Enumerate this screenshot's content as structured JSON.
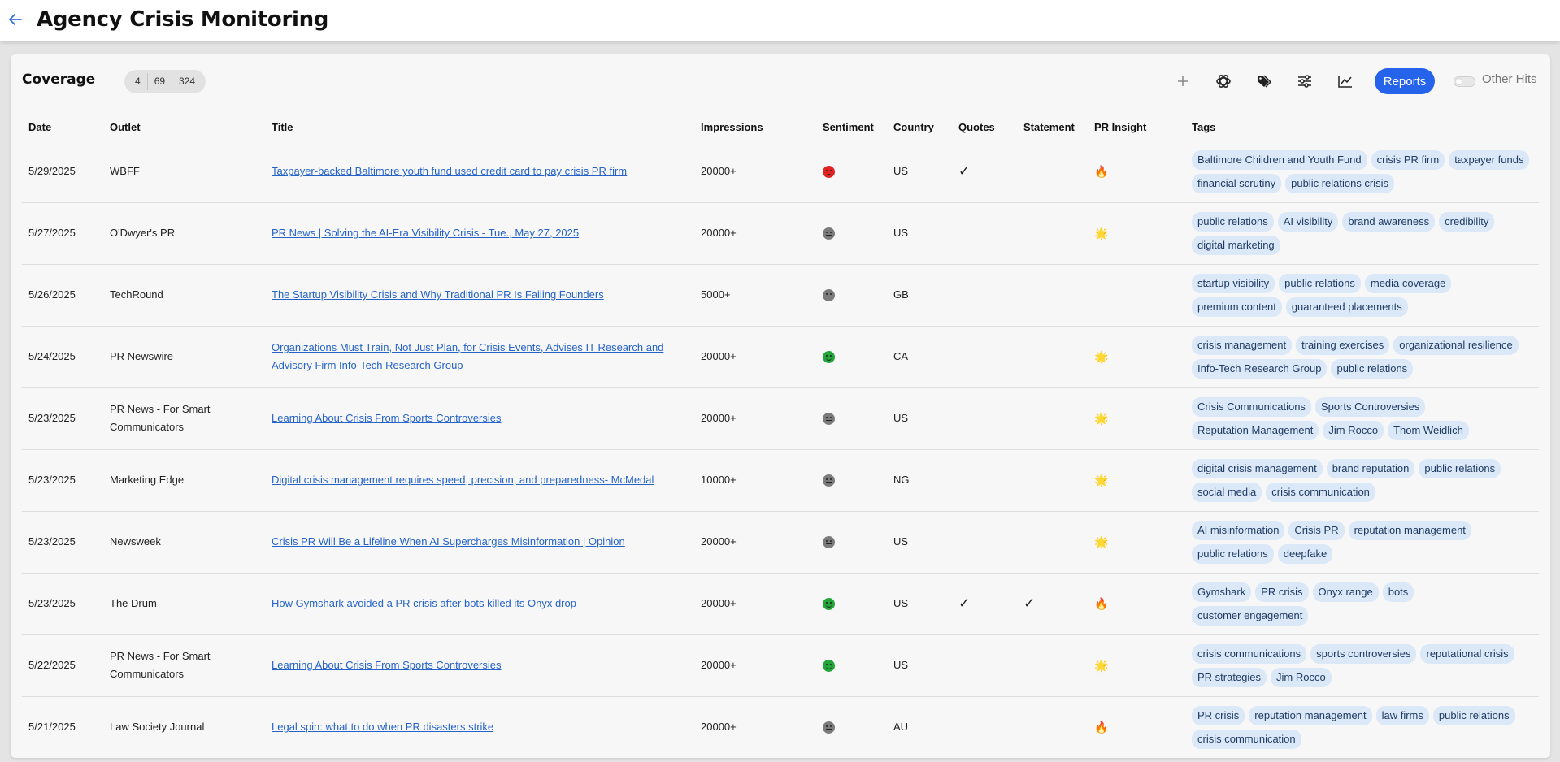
{
  "header": {
    "back_icon": "arrow-left-icon",
    "title": "Agency Crisis Monitoring"
  },
  "coverage": {
    "title": "Coverage",
    "counts": [
      "4",
      "69",
      "324"
    ],
    "toolbar": {
      "icons": [
        "plus-icon",
        "openai-icon",
        "tags-icon",
        "sliders-icon",
        "line-chart-icon"
      ],
      "reports_label": "Reports",
      "other_hits_label": "Other Hits",
      "other_hits_on": false
    },
    "columns": [
      "Date",
      "Outlet",
      "Title",
      "Impressions",
      "Sentiment",
      "Country",
      "Quotes",
      "Statement",
      "PR Insight",
      "Tags"
    ],
    "rows": [
      {
        "date": "5/29/2025",
        "outlet": "WBFF",
        "title": "Taxpayer-backed Baltimore youth fund used credit card to pay crisis PR firm",
        "impressions": "20000+",
        "sentiment": "negative",
        "country": "US",
        "quotes": "✓",
        "statement": "",
        "insight": "🔥",
        "tags": [
          "Baltimore Children and Youth Fund",
          "crisis PR firm",
          "taxpayer funds",
          "financial scrutiny",
          "public relations crisis"
        ]
      },
      {
        "date": "5/27/2025",
        "outlet": "O'Dwyer's PR",
        "title": "PR News | Solving the AI-Era Visibility Crisis - Tue., May 27, 2025",
        "impressions": "20000+",
        "sentiment": "neutral",
        "country": "US",
        "quotes": "",
        "statement": "",
        "insight": "🌟",
        "tags": [
          "public relations",
          "AI visibility",
          "brand awareness",
          "credibility",
          "digital marketing"
        ]
      },
      {
        "date": "5/26/2025",
        "outlet": "TechRound",
        "title": "The Startup Visibility Crisis and Why Traditional PR Is Failing Founders",
        "impressions": "5000+",
        "sentiment": "neutral",
        "country": "GB",
        "quotes": "",
        "statement": "",
        "insight": "",
        "tags": [
          "startup visibility",
          "public relations",
          "media coverage",
          "premium content",
          "guaranteed placements"
        ]
      },
      {
        "date": "5/24/2025",
        "outlet": "PR Newswire",
        "title": "Organizations Must Train, Not Just Plan, for Crisis Events, Advises IT Research and Advisory Firm Info-Tech Research Group",
        "impressions": "20000+",
        "sentiment": "positive",
        "country": "CA",
        "quotes": "",
        "statement": "",
        "insight": "🌟",
        "tags": [
          "crisis management",
          "training exercises",
          "organizational resilience",
          "Info-Tech Research Group",
          "public relations"
        ]
      },
      {
        "date": "5/23/2025",
        "outlet": "PR News - For Smart Communicators",
        "title": "Learning About Crisis From Sports Controversies",
        "impressions": "20000+",
        "sentiment": "neutral",
        "country": "US",
        "quotes": "",
        "statement": "",
        "insight": "🌟",
        "tags": [
          "Crisis Communications",
          "Sports Controversies",
          "Reputation Management",
          "Jim Rocco",
          "Thom Weidlich"
        ]
      },
      {
        "date": "5/23/2025",
        "outlet": "Marketing Edge",
        "title": "Digital crisis management requires speed, precision, and preparedness- McMedal",
        "impressions": "10000+",
        "sentiment": "neutral",
        "country": "NG",
        "quotes": "",
        "statement": "",
        "insight": "🌟",
        "tags": [
          "digital crisis management",
          "brand reputation",
          "public relations",
          "social media",
          "crisis communication"
        ]
      },
      {
        "date": "5/23/2025",
        "outlet": "Newsweek",
        "title": "Crisis PR Will Be a Lifeline When AI Supercharges Misinformation | Opinion",
        "impressions": "20000+",
        "sentiment": "neutral",
        "country": "US",
        "quotes": "",
        "statement": "",
        "insight": "🌟",
        "tags": [
          "AI misinformation",
          "Crisis PR",
          "reputation management",
          "public relations",
          "deepfake"
        ]
      },
      {
        "date": "5/23/2025",
        "outlet": "The Drum",
        "title": "How Gymshark avoided a PR crisis after bots killed its Onyx drop",
        "impressions": "20000+",
        "sentiment": "positive",
        "country": "US",
        "quotes": "✓",
        "statement": "✓",
        "insight": "🔥",
        "tags": [
          "Gymshark",
          "PR crisis",
          "Onyx range",
          "bots",
          "customer engagement"
        ]
      },
      {
        "date": "5/22/2025",
        "outlet": "PR News - For Smart Communicators",
        "title": "Learning About Crisis From Sports Controversies",
        "impressions": "20000+",
        "sentiment": "positive",
        "country": "US",
        "quotes": "",
        "statement": "",
        "insight": "🌟",
        "tags": [
          "crisis communications",
          "sports controversies",
          "reputational crisis",
          "PR strategies",
          "Jim Rocco"
        ]
      },
      {
        "date": "5/21/2025",
        "outlet": "Law Society Journal",
        "title": "Legal spin: what to do when PR disasters strike",
        "impressions": "20000+",
        "sentiment": "neutral",
        "country": "AU",
        "quotes": "",
        "statement": "",
        "insight": "🔥",
        "tags": [
          "PR crisis",
          "reputation management",
          "law firms",
          "public relations",
          "crisis communication"
        ]
      }
    ]
  }
}
